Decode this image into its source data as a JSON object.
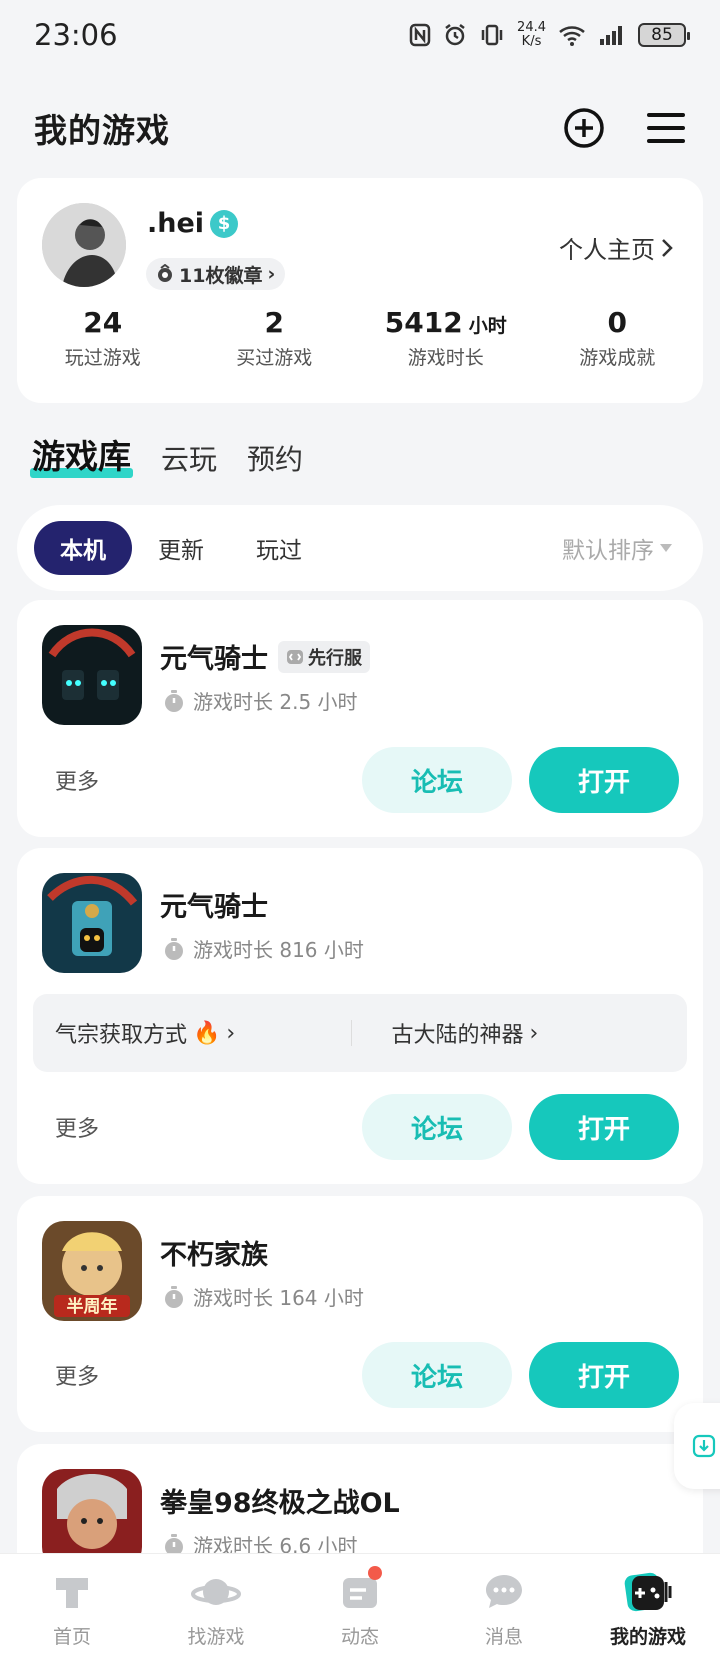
{
  "status": {
    "time": "23:06",
    "net_speed_top": "24.4",
    "net_speed_bottom": "K/s",
    "battery": "85"
  },
  "header": {
    "title": "我的游戏",
    "add_icon": "plus-circle-icon",
    "menu_icon": "hamburger-menu-icon"
  },
  "profile": {
    "username": ".hei",
    "badges_label": "11枚徽章",
    "homepage_label": "个人主页",
    "stats": [
      {
        "value": "24",
        "unit": "",
        "label": "玩过游戏"
      },
      {
        "value": "2",
        "unit": "",
        "label": "买过游戏"
      },
      {
        "value": "5412",
        "unit": "小时",
        "label": "游戏时长"
      },
      {
        "value": "0",
        "unit": "",
        "label": "游戏成就"
      }
    ]
  },
  "library_tabs": [
    "游戏库",
    "云玩",
    "预约"
  ],
  "filters": {
    "chips": [
      "本机",
      "更新",
      "玩过"
    ],
    "sort_label": "默认排序"
  },
  "games": [
    {
      "name": "元气骑士",
      "tag": "先行服",
      "playtime": "游戏时长 2.5 小时",
      "more": "更多",
      "forum": "论坛",
      "open": "打开"
    },
    {
      "name": "元气骑士",
      "playtime": "游戏时长 816 小时",
      "topics": [
        "气宗获取方式",
        "古大陆的神器"
      ],
      "more": "更多",
      "forum": "论坛",
      "open": "打开"
    },
    {
      "name": "不朽家族",
      "playtime": "游戏时长 164 小时",
      "icon_text": "半周年",
      "more": "更多",
      "forum": "论坛",
      "open": "打开"
    },
    {
      "name": "拳皇98终极之战OL",
      "playtime": "游戏时长 6.6 小时"
    }
  ],
  "bottom_nav": [
    "首页",
    "找游戏",
    "动态",
    "消息",
    "我的游戏"
  ],
  "colors": {
    "accent": "#16c8bc",
    "chip_active": "#24236e",
    "notify": "#f35a4a"
  }
}
